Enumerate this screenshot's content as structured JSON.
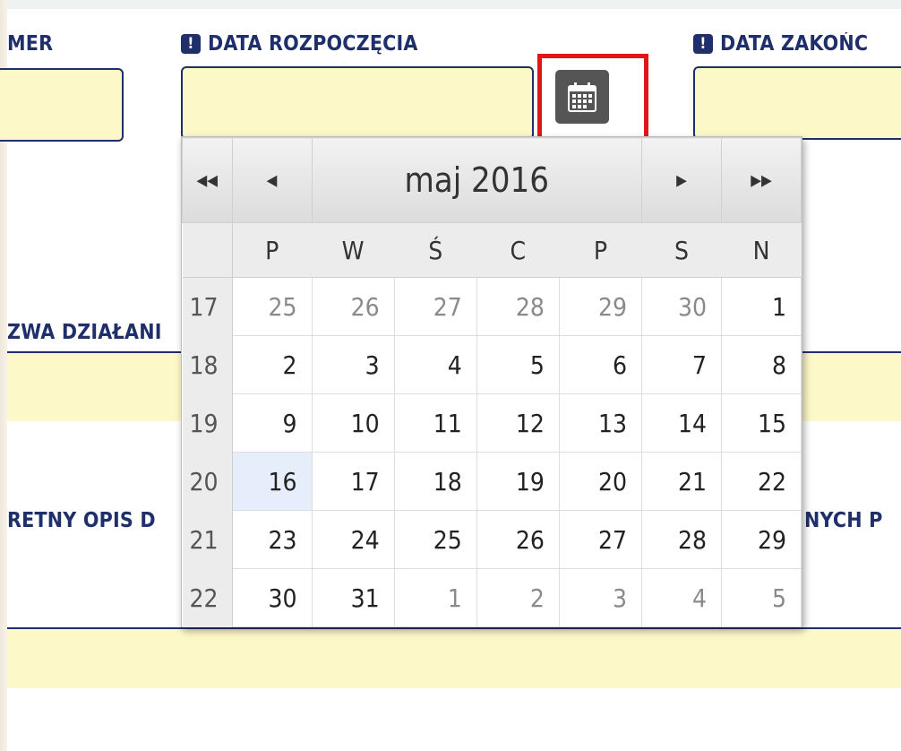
{
  "labels": {
    "numer": "MER",
    "data_rozpoczecia": "DATA ROZPOCZĘCIA",
    "data_zakonczenia": "DATA ZAKOŃC",
    "nazwa_dzialania": "ZWA DZIAŁANI",
    "opis": "RETNY OPIS D",
    "right_partial": "NYCH P"
  },
  "required_icon": "!",
  "icons": {
    "calendar": "calendar-icon",
    "required": "exclamation-icon"
  },
  "colors": {
    "label": "#1f2f6b",
    "field_bg": "#fdf8c7",
    "highlight": "#e0161c"
  },
  "datepicker": {
    "title": "maj 2016",
    "nav": {
      "prev_year": "◂◂",
      "prev_month": "◂",
      "next_month": "▸",
      "next_year": "▸▸"
    },
    "weekdays": [
      "P",
      "W",
      "Ś",
      "C",
      "P",
      "S",
      "N"
    ],
    "weeks": [
      {
        "wk": "17",
        "days": [
          "25",
          "26",
          "27",
          "28",
          "29",
          "30",
          "1"
        ]
      },
      {
        "wk": "18",
        "days": [
          "2",
          "3",
          "4",
          "5",
          "6",
          "7",
          "8"
        ]
      },
      {
        "wk": "19",
        "days": [
          "9",
          "10",
          "11",
          "12",
          "13",
          "14",
          "15"
        ]
      },
      {
        "wk": "20",
        "days": [
          "16",
          "17",
          "18",
          "19",
          "20",
          "21",
          "22"
        ]
      },
      {
        "wk": "21",
        "days": [
          "23",
          "24",
          "25",
          "26",
          "27",
          "28",
          "29"
        ]
      },
      {
        "wk": "22",
        "days": [
          "30",
          "31",
          "1",
          "2",
          "3",
          "4",
          "5"
        ]
      }
    ],
    "today": "16"
  }
}
